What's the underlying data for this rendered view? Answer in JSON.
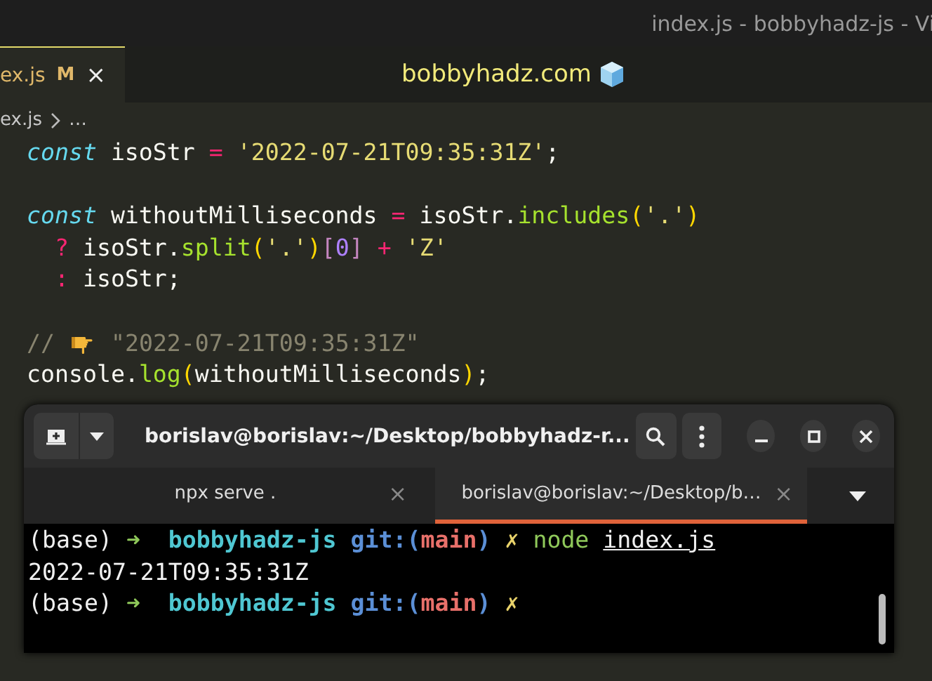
{
  "window": {
    "title": "index.js - bobbyhadz-js - Vi"
  },
  "editor_tabs": [
    {
      "label": "ex.js",
      "badge": "M",
      "close": "×",
      "selected": true
    }
  ],
  "banner": {
    "text": "bobbyhadz.com"
  },
  "breadcrumb": {
    "file": "ex.js",
    "more": "…"
  },
  "code_blocks": [
    [
      [
        {
          "kind": "kw",
          "text": "const"
        },
        {
          "kind": "id",
          "text": " isoStr "
        },
        {
          "kind": "op",
          "text": "="
        },
        {
          "kind": "str",
          "text": " '2022-07-21T09:35:31Z'"
        },
        {
          "kind": "id",
          "text": ";"
        }
      ]
    ],
    [
      [
        {
          "kind": "kw",
          "text": "const"
        },
        {
          "kind": "id",
          "text": " withoutMilliseconds "
        },
        {
          "kind": "op",
          "text": "="
        },
        {
          "kind": "id",
          "text": " isoStr."
        },
        {
          "kind": "fn",
          "text": "includes"
        },
        {
          "kind": "br",
          "text": "("
        },
        {
          "kind": "str",
          "text": "'.'"
        },
        {
          "kind": "br",
          "text": ")"
        }
      ],
      [
        {
          "kind": "op",
          "text": "  ?"
        },
        {
          "kind": "id",
          "text": " isoStr."
        },
        {
          "kind": "fn",
          "text": "split"
        },
        {
          "kind": "br",
          "text": "("
        },
        {
          "kind": "str",
          "text": "'.'"
        },
        {
          "kind": "br",
          "text": ")"
        },
        {
          "kind": "br2",
          "text": "["
        },
        {
          "kind": "num",
          "text": "0"
        },
        {
          "kind": "br2",
          "text": "]"
        },
        {
          "kind": "op",
          "text": " + "
        },
        {
          "kind": "str",
          "text": "'Z'"
        }
      ],
      [
        {
          "kind": "op",
          "text": "  :"
        },
        {
          "kind": "id",
          "text": " isoStr;"
        }
      ]
    ],
    [
      [
        {
          "kind": "cm",
          "text": "// "
        },
        {
          "kind": "hand"
        },
        {
          "kind": "cm",
          "text": " \"2022-07-21T09:35:31Z\""
        }
      ],
      [
        {
          "kind": "id",
          "text": "console."
        },
        {
          "kind": "fn",
          "text": "log"
        },
        {
          "kind": "br",
          "text": "("
        },
        {
          "kind": "id",
          "text": "withoutMilliseconds"
        },
        {
          "kind": "br",
          "text": ")"
        },
        {
          "kind": "id",
          "text": ";"
        }
      ]
    ]
  ],
  "terminal": {
    "title": "borislav@borislav:~/Desktop/bobbyhadz-r...",
    "tabs": [
      {
        "label": "npx serve .",
        "close": "×",
        "selected": false
      },
      {
        "label": "borislav@borislav:~/Desktop/b…",
        "close": "×",
        "selected": true
      }
    ],
    "lines": [
      [
        {
          "kind": "plain",
          "text": "(base) "
        },
        {
          "kind": "arrow",
          "text": "➜"
        },
        {
          "kind": "dir",
          "text": "  bobbyhadz-js"
        },
        {
          "kind": "git",
          "text": " git:("
        },
        {
          "kind": "branch",
          "text": "main"
        },
        {
          "kind": "git",
          "text": ")"
        },
        {
          "kind": "x",
          "text": " ✗"
        },
        {
          "kind": "cmd",
          "text": " node "
        },
        {
          "kind": "arg",
          "text": "index.js"
        }
      ],
      [
        {
          "kind": "plain",
          "text": "2022-07-21T09:35:31Z"
        }
      ],
      [
        {
          "kind": "plain",
          "text": "(base) "
        },
        {
          "kind": "arrow",
          "text": "➜"
        },
        {
          "kind": "dir",
          "text": "  bobbyhadz-js"
        },
        {
          "kind": "git",
          "text": " git:("
        },
        {
          "kind": "branch",
          "text": "main"
        },
        {
          "kind": "git",
          "text": ")"
        },
        {
          "kind": "x",
          "text": " ✗"
        }
      ]
    ]
  }
}
